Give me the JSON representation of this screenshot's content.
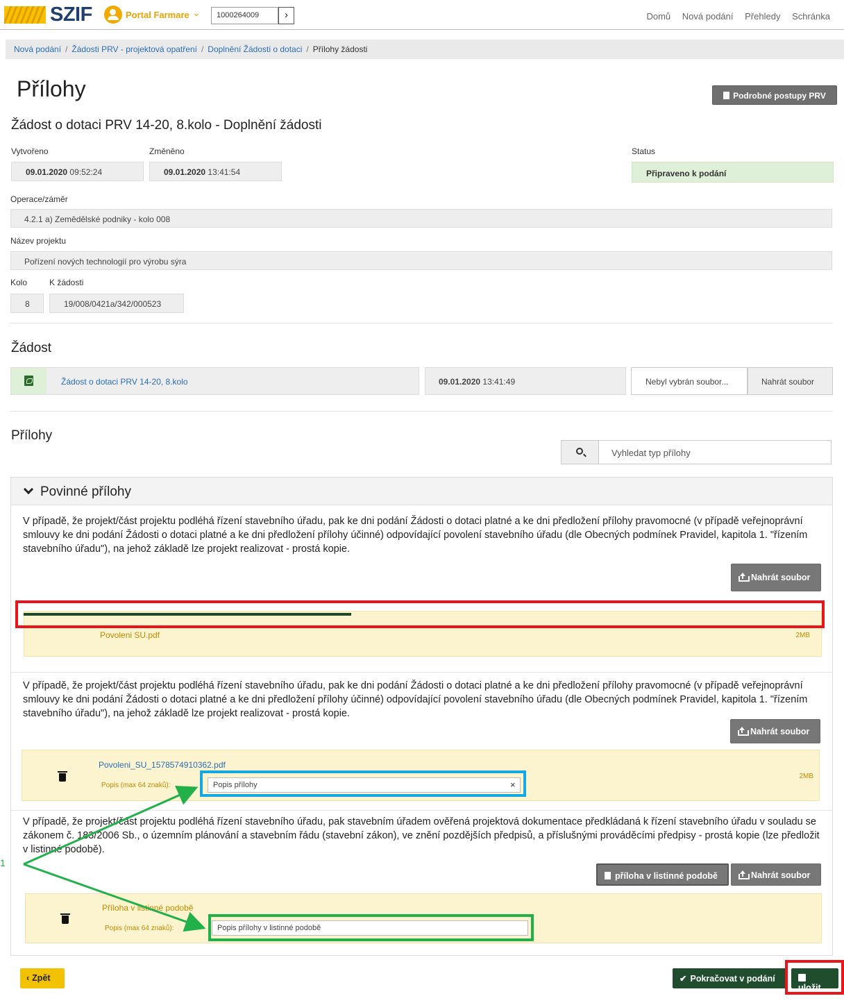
{
  "header": {
    "brand": "SZIF",
    "portal_label": "Portal Farmare",
    "id_value": "1000264009",
    "nav": [
      "Domů",
      "Nová podání",
      "Přehledy",
      "Schránka"
    ]
  },
  "breadcrumb": {
    "items": [
      "Nová podání",
      "Žádosti PRV - projektová opatření",
      "Doplnění Žádosti o dotaci"
    ],
    "current": "Přílohy žádosti"
  },
  "page": {
    "title": "Přílohy",
    "help_button": "Podrobné postupy PRV",
    "subtitle": "Žádost o dotaci PRV 14-20, 8.kolo - Doplnění žádosti"
  },
  "info": {
    "created_label": "Vytvořeno",
    "created_date": "09.01.2020",
    "created_time": "09:52:24",
    "changed_label": "Změněno",
    "changed_date": "09.01.2020",
    "changed_time": "13:41:54",
    "status_label": "Status",
    "status_value": "Připraveno k podání",
    "operation_label": "Operace/záměr",
    "operation_value": "4.2.1 a) Zemědělské podniky - kolo 008",
    "project_label": "Název projektu",
    "project_value": "Pořízení nových technologií pro výrobu sýra",
    "round_label": "Kolo",
    "round_value": "8",
    "request_label": "K žádosti",
    "request_value": "19/008/0421a/342/000523"
  },
  "zadost": {
    "heading": "Žádost",
    "link": "Žádost o dotaci PRV 14-20, 8.kolo",
    "date": "09.01.2020",
    "time": "13:41:49",
    "no_file": "Nebyl vybrán soubor...",
    "upload": "Nahrát soubor"
  },
  "prilohy": {
    "heading": "Přílohy",
    "search_placeholder": "Vyhledat typ přílohy",
    "panel_title": "Povinné přílohy",
    "para1": "V případě, že projekt/část projektu podléhá řízení stavebního úřadu, pak ke dni podání Žádosti o dotaci platné a ke dni předložení přílohy pravomocné (v případě veřejnoprávní smlouvy ke dni podání Žádosti o dotaci platné a ke dni předložení přílohy účinné) odpovídající povolení stavebního úřadu (dle Obecných podmínek Pravidel, kapitola 1. \"řízením stavebního úřadu\"), na jehož základě lze projekt realizovat - prostá kopie.",
    "para2": "V případě, že projekt/část projektu podléhá řízení stavebního úřadu, pak ke dni podání Žádosti o dotaci platné a ke dni předložení přílohy pravomocné (v případě veřejnoprávní smlouvy ke dni podání Žádosti o dotaci platné a ke dni předložení přílohy účinné) odpovídající povolení stavebního úřadu (dle Obecných podmínek Pravidel, kapitola 1. \"řízením stavebního úřadu\"), na jehož základě lze projekt realizovat - prostá kopie.",
    "para3": "V případě, že projekt/část projektu podléhá řízení stavebního úřadu, pak stavebním úřadem ověřená projektová dokumentace předkládaná k řízení stavebního úřadu v souladu se zákonem č. 183/2006 Sb., o územním plánování a stavebním řádu (stavební zákon), ve znění pozdějších předpisů, a příslušnými prováděcími předpisy - prostá kopie (lze předložit v listinné podobě).",
    "upload_label": "Nahrát soubor",
    "paper_button": "příloha v listinné podobě",
    "file1_name": "Povoleni SU.pdf",
    "file1_size": "2MB",
    "upload_progress": 0.41,
    "file2_name": "Povoleni_SU_1578574910362.pdf",
    "file2_size": "2MB",
    "desc_label": "Popis (max 64 znaků):",
    "desc2_value": "Popis přílohy",
    "file3_name": "Příloha v listinné podobě",
    "desc3_value": "Popis přílohy v listinné podobě"
  },
  "footer": {
    "back": "Zpět",
    "continue": "Pokračovat v podání",
    "save": "uložit"
  },
  "annotation": {
    "number": "1"
  },
  "colors": {
    "brand_blue": "#1f3f6e",
    "accent_yellow": "#f2a900",
    "status_green": "#dff0d8",
    "dark_green": "#1f4d2d",
    "highlight_red": "#e8151b",
    "highlight_blue": "#16a8e0",
    "highlight_green": "#22b04b"
  }
}
